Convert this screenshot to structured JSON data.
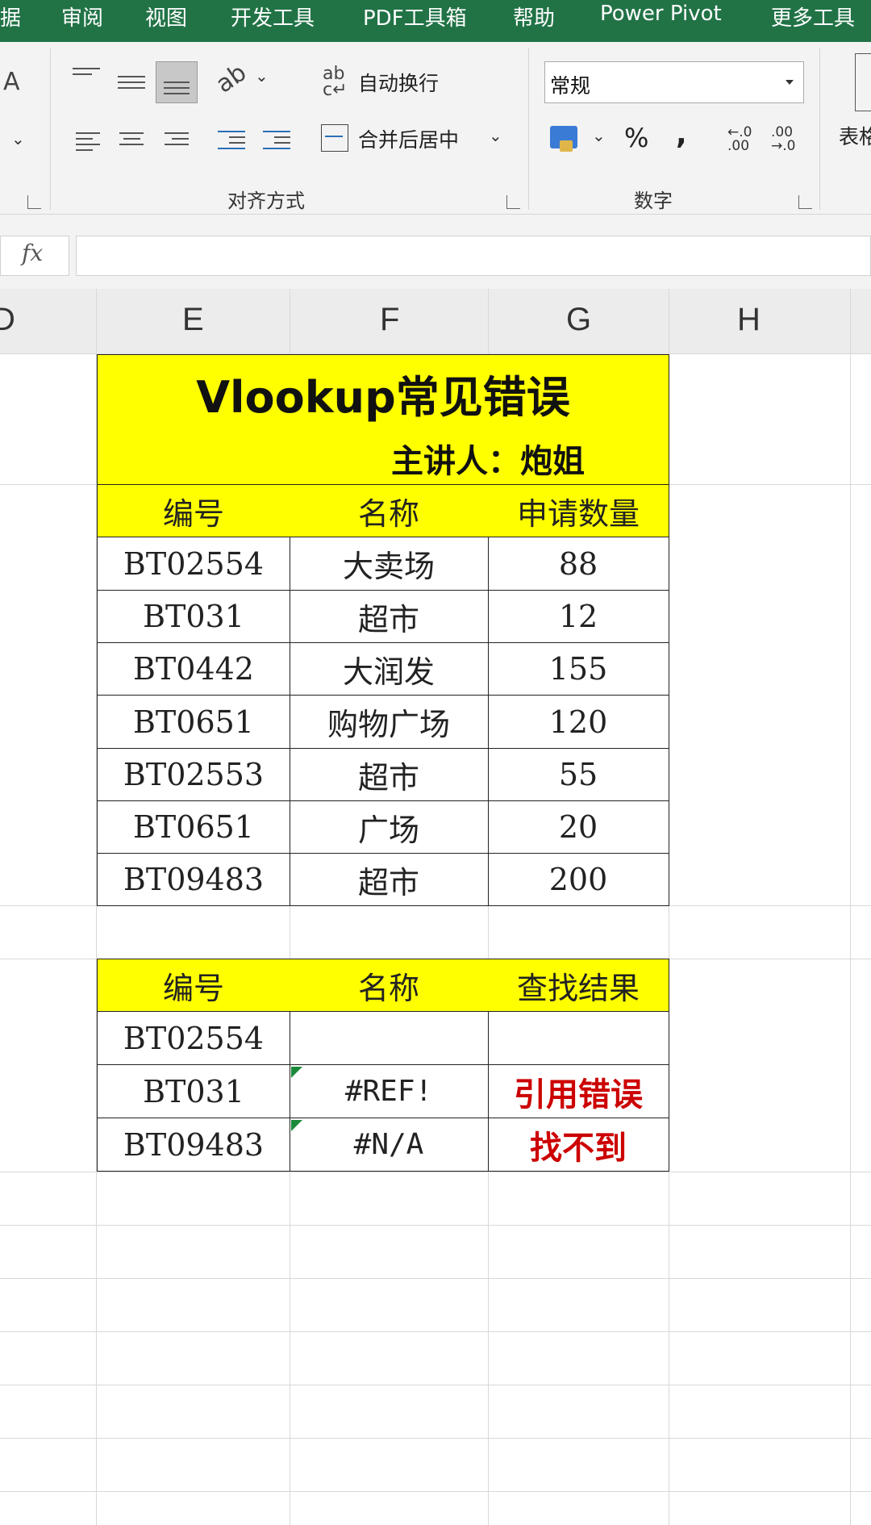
{
  "menu_tabs": [
    "据",
    "审阅",
    "视图",
    "开发工具",
    "PDF工具箱",
    "帮助",
    "Power Pivot",
    "更多工具"
  ],
  "ribbon": {
    "wrap_text": "自动换行",
    "merge_center": "合并后居中",
    "alignment_group": "对齐方式",
    "number_format": "常规",
    "percent": "%",
    "comma": ",",
    "number_group": "数字",
    "table_label": "表格",
    "font_label": "A"
  },
  "formula_bar": {
    "fx": "fx",
    "value": ""
  },
  "columns": [
    "D",
    "E",
    "F",
    "G",
    "H"
  ],
  "sheet": {
    "title": "Vlookup常见错误",
    "presenter": "主讲人：炮姐",
    "table1": {
      "headers": [
        "编号",
        "名称",
        "申请数量"
      ],
      "rows": [
        [
          "BT02554",
          "大卖场",
          "88"
        ],
        [
          "BT031",
          "超市",
          "12"
        ],
        [
          "BT0442",
          "大润发",
          "155"
        ],
        [
          "BT0651",
          "购物广场",
          "120"
        ],
        [
          "BT02553",
          "超市",
          "55"
        ],
        [
          "BT0651",
          "广场",
          "20"
        ],
        [
          "BT09483",
          "超市",
          "200"
        ]
      ]
    },
    "table2": {
      "headers": [
        "编号",
        "名称",
        "查找结果"
      ],
      "rows": [
        [
          "BT02554",
          "",
          ""
        ],
        [
          "BT031",
          "#REF!",
          "引用错误"
        ],
        [
          "BT09483",
          "#N/A",
          "找不到"
        ]
      ]
    }
  },
  "colors": {
    "ribbon_green": "#217346",
    "header_yellow": "#ffff00",
    "error_red": "#cc0000"
  }
}
